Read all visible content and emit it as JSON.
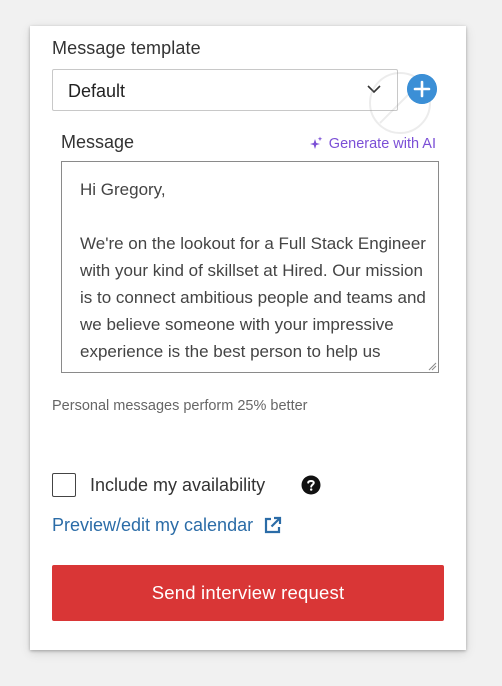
{
  "template": {
    "label": "Message template",
    "selected": "Default"
  },
  "message": {
    "label": "Message",
    "generate_ai_label": "Generate with AI",
    "body": "Hi Gregory,\n\nWe're on the lookout for a Full Stack Engineer with your kind of skillset at Hired. Our mission is to connect ambitious people and teams and we believe someone with your impressive experience is the best person to help us\nreach our goals."
  },
  "hint": "Personal messages perform 25% better",
  "availability": {
    "checkbox_checked": false,
    "label": "Include my availability"
  },
  "calendar_link": "Preview/edit my calendar",
  "send_button": "Send interview request",
  "colors": {
    "accent_blue": "#3b8fd6",
    "link_blue": "#2b6ca7",
    "ai_purple": "#7b4fd6",
    "send_red": "#d93636"
  },
  "icons": {
    "select": "chevron-down-icon",
    "add": "plus-circle-icon",
    "ai": "sparkle-icon",
    "help": "question-circle-icon",
    "external": "external-link-icon"
  }
}
